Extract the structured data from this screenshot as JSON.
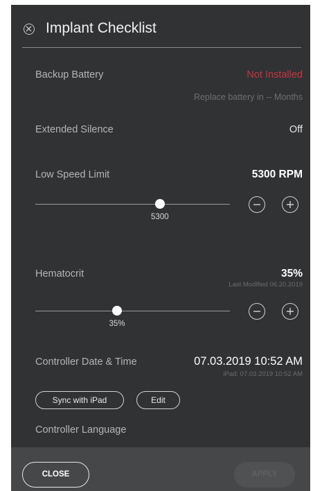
{
  "header": {
    "title": "Implant Checklist",
    "close_icon": "close-circle-icon"
  },
  "backup_battery": {
    "label": "Backup Battery",
    "status": "Not Installed",
    "status_color": "#c8363e",
    "note": "Replace battery in -- Months"
  },
  "extended_silence": {
    "label": "Extended Silence",
    "value": "Off"
  },
  "low_speed_limit": {
    "label": "Low Speed Limit",
    "value": "5300 RPM",
    "slider_value": "5300",
    "slider_fraction": 0.64,
    "decrement_icon": "minus-circle-icon",
    "increment_icon": "plus-circle-icon"
  },
  "hematocrit": {
    "label": "Hematocrit",
    "value": "35%",
    "last_modified": "Last Modified 06.20.2019",
    "slider_value": "35%",
    "slider_fraction": 0.42,
    "decrement_icon": "minus-circle-icon",
    "increment_icon": "plus-circle-icon"
  },
  "controller_datetime": {
    "label": "Controller Date & Time",
    "value": "07.03.2019 10:52 AM",
    "ipad_time": "iPad: 07.03.2019 10:52 AM",
    "sync_button": "Sync with iPad",
    "edit_button": "Edit"
  },
  "controller_language": {
    "label": "Controller Language"
  },
  "footer": {
    "close_label": "CLOSE",
    "apply_label": "APPLY"
  }
}
